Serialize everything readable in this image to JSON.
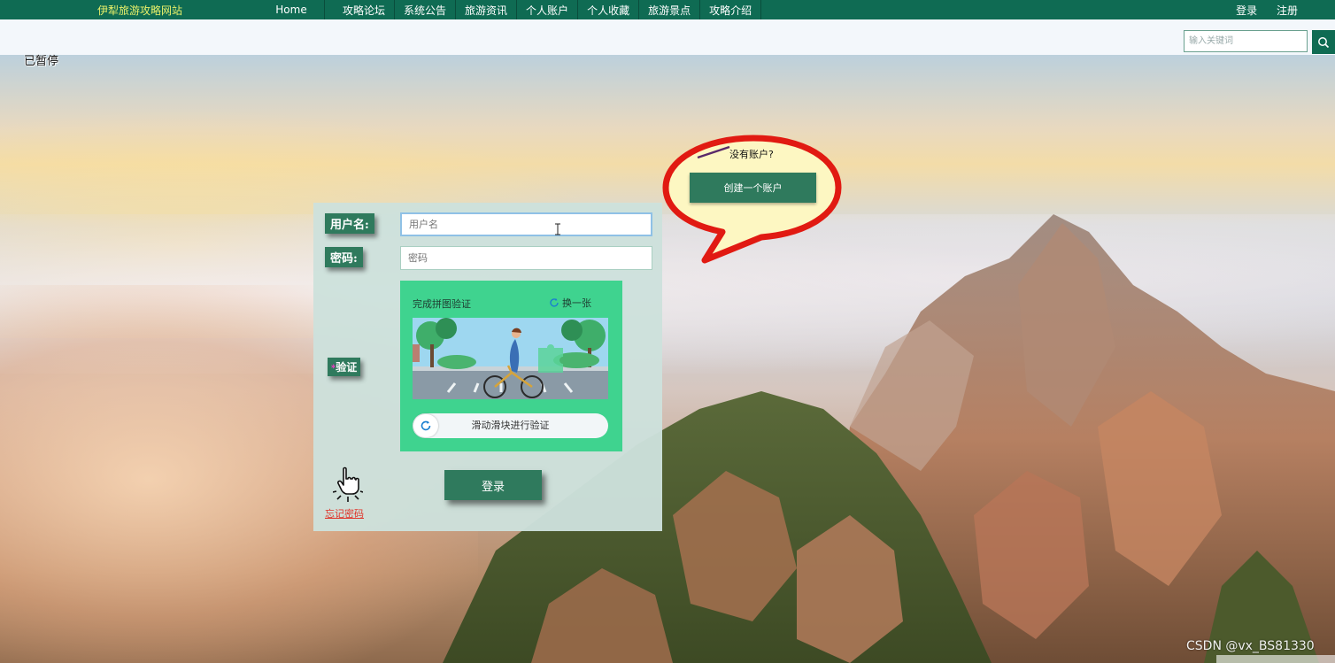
{
  "nav": {
    "brand": "伊犁旅游攻略网站",
    "items": [
      "Home",
      "攻略论坛",
      "系统公告",
      "旅游资讯",
      "个人账户",
      "个人收藏",
      "旅游景点",
      "攻略介绍"
    ],
    "login": "登录",
    "register": "注册"
  },
  "search": {
    "placeholder": "输入关键词",
    "button_icon": "search-icon"
  },
  "overlay": {
    "paused": "已暂停"
  },
  "login_form": {
    "username_label": "用户名:",
    "username_placeholder": "用户名",
    "password_label": "密码:",
    "password_placeholder": "密码",
    "verify_label": "验证",
    "verify_required_mark": "*",
    "captcha_title": "完成拼图验证",
    "captcha_refresh": "换一张",
    "slider_text": "滑动滑块进行验证",
    "submit": "登录",
    "forgot": "忘记密码"
  },
  "signup_bubble": {
    "prompt": "没有账户?",
    "button": "创建一个账户"
  },
  "watermark": "CSDN @vx_BS81330",
  "colors": {
    "nav_bg": "#0f6b53",
    "brand_text": "#e9f06a",
    "primary_button": "#2f7a5d",
    "captcha_bg": "#3fd38f",
    "link_red": "#e0342a",
    "bubble_stroke": "#e11a12",
    "bubble_fill": "#fdf7c2"
  }
}
